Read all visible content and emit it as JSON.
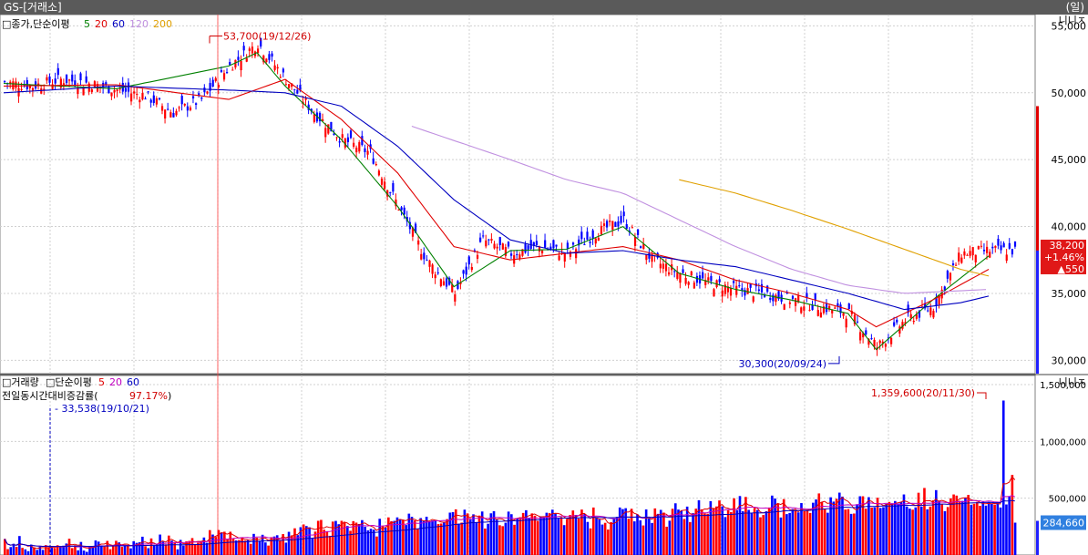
{
  "window": {
    "title": "GS-[거래소]",
    "period": "(일)"
  },
  "price_panel": {
    "legend_box": "□",
    "legend_title": "종가,단순이평",
    "legend_ma": [
      {
        "label": "5",
        "color": "#008000"
      },
      {
        "label": "20",
        "color": "#e00000"
      },
      {
        "label": "60",
        "color": "#0000c0"
      },
      {
        "label": "120",
        "color": "#c090e0"
      },
      {
        "label": "200",
        "color": "#e0a000"
      }
    ],
    "corner_buttons": "니니ㅈ",
    "high_label": "53,700(19/12/26)",
    "low_label": "30,300(20/09/24)",
    "current_price": "38,200",
    "change_pct": "+1.46%",
    "change_amt": "▲550",
    "accent_up": "#e00000",
    "accent_down": "#0000ff"
  },
  "volume_panel": {
    "legend_box": "□",
    "legend_title": "거래량",
    "legend_box2": "□",
    "legend_title2": "단순이평",
    "legend_ma": [
      {
        "label": "5",
        "color": "#e00000"
      },
      {
        "label": "20",
        "color": "#c000c0"
      },
      {
        "label": "60",
        "color": "#0000c0"
      }
    ],
    "ratio_label": "전일동시간대비증감률(",
    "ratio_value": "97.17%",
    "ratio_close": ")",
    "corner_buttons": "니니ㅈ",
    "min_label": "33,538(19/10/21)",
    "max_label": "1,359,600(20/11/30)",
    "current_volume": "284,660"
  },
  "chart_data": [
    {
      "type": "line",
      "title": "종가,단순이평",
      "y_ticks": [
        "55,000",
        "50,000",
        "45,000",
        "40,000",
        "35,000",
        "30,000"
      ],
      "ylim": [
        29000,
        55300
      ],
      "grid": true,
      "series": [
        {
          "name": "종가",
          "x_index": [
            0,
            10,
            20,
            30,
            40,
            50,
            60,
            70,
            80,
            90,
            100,
            110,
            120,
            130,
            140,
            150,
            160,
            170,
            180,
            190,
            200,
            210,
            220,
            230,
            240,
            250,
            260,
            270,
            280,
            290,
            300,
            310,
            320,
            330,
            340,
            350
          ],
          "values": [
            50800,
            50500,
            51000,
            50700,
            50200,
            49800,
            48500,
            49500,
            52000,
            53700,
            51000,
            48500,
            46500,
            45500,
            41500,
            37500,
            35000,
            39000,
            38000,
            38500,
            38000,
            39500,
            40500,
            37500,
            36500,
            35800,
            35300,
            35000,
            34500,
            34000,
            33500,
            31000,
            33000,
            34000,
            38000,
            38200
          ]
        },
        {
          "name": "5",
          "x_index": [
            0,
            40,
            80,
            90,
            100,
            120,
            140,
            160,
            180,
            200,
            220,
            240,
            260,
            280,
            300,
            310,
            330,
            350
          ],
          "values": [
            50700,
            50300,
            52000,
            53000,
            50500,
            46500,
            41500,
            35500,
            38200,
            38300,
            40000,
            36500,
            35300,
            34500,
            33500,
            30800,
            34500,
            37800
          ]
        },
        {
          "name": "20",
          "x_index": [
            0,
            40,
            80,
            100,
            120,
            140,
            160,
            180,
            200,
            220,
            240,
            260,
            280,
            300,
            310,
            330,
            350
          ],
          "values": [
            50500,
            50600,
            49500,
            51000,
            48000,
            44000,
            38500,
            37500,
            38000,
            38500,
            37500,
            36000,
            35000,
            33800,
            32500,
            34500,
            36800
          ]
        },
        {
          "name": "60",
          "x_index": [
            0,
            40,
            80,
            100,
            120,
            140,
            160,
            180,
            200,
            220,
            240,
            260,
            280,
            300,
            320,
            340,
            350
          ],
          "values": [
            50000,
            50500,
            50200,
            50000,
            49000,
            46000,
            42000,
            39000,
            38000,
            38200,
            37500,
            37000,
            36000,
            35000,
            33800,
            34300,
            34800
          ]
        },
        {
          "name": "120",
          "x_index": [
            145,
            180,
            200,
            220,
            240,
            260,
            280,
            300,
            320,
            350
          ],
          "values": [
            47500,
            45000,
            43500,
            42500,
            40500,
            38500,
            36800,
            35600,
            35000,
            35300
          ]
        },
        {
          "name": "200",
          "x_index": [
            240,
            260,
            280,
            300,
            320,
            340,
            350
          ],
          "values": [
            43500,
            42500,
            41200,
            39800,
            38300,
            36800,
            36300
          ]
        }
      ]
    },
    {
      "type": "bar",
      "title": "거래량",
      "y_ticks": [
        "1,500,000",
        "1,000,000",
        "500,000"
      ],
      "ylim": [
        0,
        1500000
      ],
      "grid": true,
      "values": [
        141000,
        52000,
        70000,
        99000,
        72000,
        167000,
        63000,
        50000,
        33538,
        92000,
        68000,
        45000,
        73000,
        45000,
        87000,
        70000,
        64000,
        61000,
        86000,
        68000,
        82000,
        101000,
        143000,
        61000,
        86000,
        41000,
        115000,
        39000,
        28000,
        77000,
        76000,
        128000,
        118000,
        83000,
        75000,
        124000,
        51000,
        88000,
        125000,
        111000,
        72000,
        84000,
        87000,
        59000,
        121000,
        107000,
        112000,
        161000,
        78000,
        60000,
        146000,
        83000,
        94000,
        180000,
        118000,
        94000,
        171000,
        126000,
        111000,
        50000,
        133000,
        83000,
        120000,
        124000,
        149000,
        97000,
        108000,
        118000,
        154000,
        107000,
        219000,
        180000,
        159000,
        220000,
        199000,
        205000,
        137000,
        205000,
        144000,
        128000,
        132000,
        154000,
        126000,
        132000,
        98000,
        186000,
        152000,
        125000,
        178000,
        111000,
        83000,
        157000,
        163000,
        174000,
        128000,
        184000,
        109000,
        204000,
        173000,
        235000,
        175000,
        245000,
        269000,
        255000,
        244000,
        150000,
        206000,
        301000,
        309000,
        223000,
        209000,
        169000,
        294000,
        300000,
        271000,
        301000,
        285000,
        255000,
        213000,
        298000,
        285000,
        273000,
        307000,
        249000,
        217000,
        231000,
        223000,
        163000,
        319000,
        256000,
        241000,
        331000,
        297000,
        300000,
        331000,
        311000,
        306000,
        264000,
        364000,
        336000,
        305000,
        232000,
        325000,
        303000,
        337000,
        296000,
        304000,
        302000,
        272000,
        277000,
        286000,
        316000,
        373000,
        377000,
        402000,
        276000,
        285000,
        399000,
        366000,
        311000,
        358000,
        290000,
        347000,
        383000,
        233000,
        275000,
        367000,
        386000,
        310000,
        262000,
        254000,
        284000,
        382000,
        359000,
        266000,
        320000,
        317000,
        370000,
        394000,
        329000,
        366000,
        346000,
        300000,
        341000,
        334000,
        372000,
        368000,
        399000,
        364000,
        324000,
        335000,
        263000,
        315000,
        352000,
        392000,
        353000,
        321000,
        400000,
        361000,
        291000,
        234000,
        418000,
        331000,
        312000,
        268000,
        283000,
        224000,
        289000,
        322000,
        336000,
        418000,
        404000,
        412000,
        319000,
        407000,
        296000,
        358000,
        305000,
        260000,
        401000,
        322000,
        282000,
        410000,
        362000,
        397000,
        373000,
        249000,
        302000,
        407000,
        455000,
        400000,
        389000,
        317000,
        426000,
        290000,
        368000,
        408000,
        482000,
        402000,
        367000,
        363000,
        474000,
        414000,
        427000,
        480000,
        428000,
        334000,
        394000,
        378000,
        499000,
        394000,
        519000,
        385000,
        511000,
        397000,
        365000,
        408000,
        396000,
        332000,
        352000,
        385000,
        418000,
        523000,
        497000,
        452000,
        330000,
        492000,
        360000,
        370000,
        404000,
        395000,
        375000,
        457000,
        385000,
        389000,
        370000,
        460000,
        489000,
        542000,
        466000,
        401000,
        372000,
        508000,
        470000,
        495000,
        549000,
        514000,
        400000,
        404000,
        362000,
        365000,
        447000,
        517000,
        517000,
        408000,
        509000,
        417000,
        420000,
        504000,
        414000,
        421000,
        449000,
        467000,
        455000,
        475000,
        453000,
        469000,
        533000,
        427000,
        408000,
        399000,
        419000,
        548000,
        426000,
        590000,
        402000,
        426000,
        481000,
        571000,
        479000,
        450000,
        386000,
        422000,
        499000,
        533000,
        523000,
        477000,
        476000,
        505000,
        529000,
        442000,
        451000,
        467000,
        433000,
        469000,
        435000,
        466000,
        452000,
        443000,
        465000,
        418000,
        1359600,
        445000,
        513000,
        705000,
        284660
      ]
    }
  ]
}
